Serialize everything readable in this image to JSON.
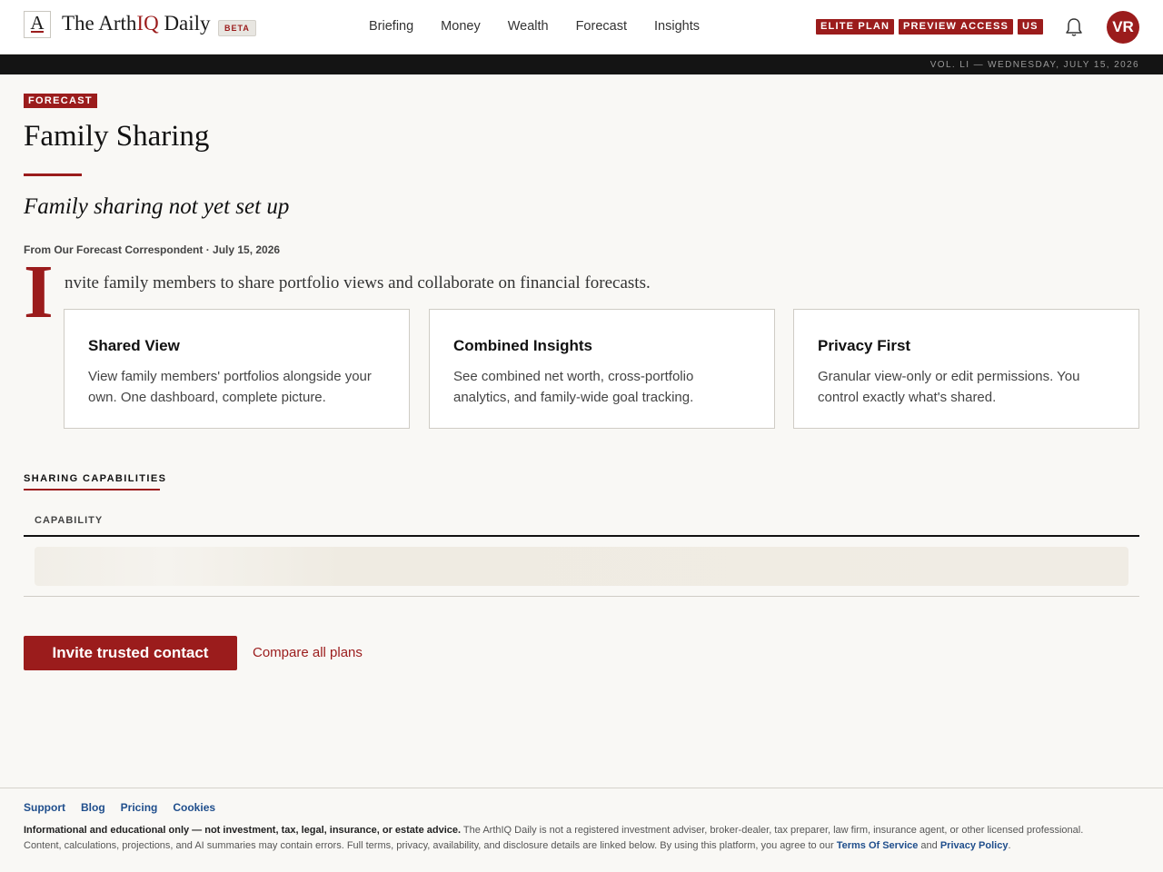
{
  "header": {
    "logo_letter": "A",
    "brand_prefix": "The Arth",
    "brand_accent": "IQ",
    "brand_suffix": " Daily",
    "beta_label": "BETA",
    "nav": [
      "Briefing",
      "Money",
      "Wealth",
      "Forecast",
      "Insights"
    ],
    "pills": [
      "ELITE PLAN",
      "PREVIEW ACCESS",
      "US"
    ],
    "avatar_initials": "VR",
    "dateline": "VOL. LI — WEDNESDAY, JULY 15, 2026"
  },
  "article": {
    "kicker": "FORECAST",
    "title": "Family Sharing",
    "subtitle": "Family sharing not yet set up",
    "byline": "From Our Forecast Correspondent · July 15, 2026",
    "dropcap": "I",
    "lede": "nvite family members to share portfolio views and collaborate on financial forecasts.",
    "cards": [
      {
        "title": "Shared View",
        "body": "View family members' portfolios alongside your own. One dashboard, complete picture."
      },
      {
        "title": "Combined Insights",
        "body": "See combined net worth, cross-portfolio analytics, and family-wide goal tracking."
      },
      {
        "title": "Privacy First",
        "body": "Granular view-only or edit permissions. You control exactly what's shared."
      }
    ]
  },
  "capabilities": {
    "section_label": "SHARING CAPABILITIES",
    "column_header": "CAPABILITY"
  },
  "actions": {
    "primary": "Invite trusted contact",
    "secondary": "Compare all plans"
  },
  "footer": {
    "links": [
      "Support",
      "Blog",
      "Pricing",
      "Cookies"
    ],
    "disclaimer_bold": "Informational and educational only — not investment, tax, legal, insurance, or estate advice.",
    "disclaimer_text": " The ArthIQ Daily is not a registered investment adviser, broker-dealer, tax preparer, law firm, insurance agent, or other licensed professional. Content, calculations, projections, and AI summaries may contain errors. Full terms, privacy, availability, and disclosure details are linked below. By using this platform, you agree to our ",
    "terms_link": "Terms Of Service",
    "and_text": " and ",
    "privacy_link": "Privacy Policy",
    "period": "."
  },
  "colors": {
    "accent": "#9b1c1c",
    "link": "#1f4e8c",
    "background": "#f9f8f5"
  }
}
